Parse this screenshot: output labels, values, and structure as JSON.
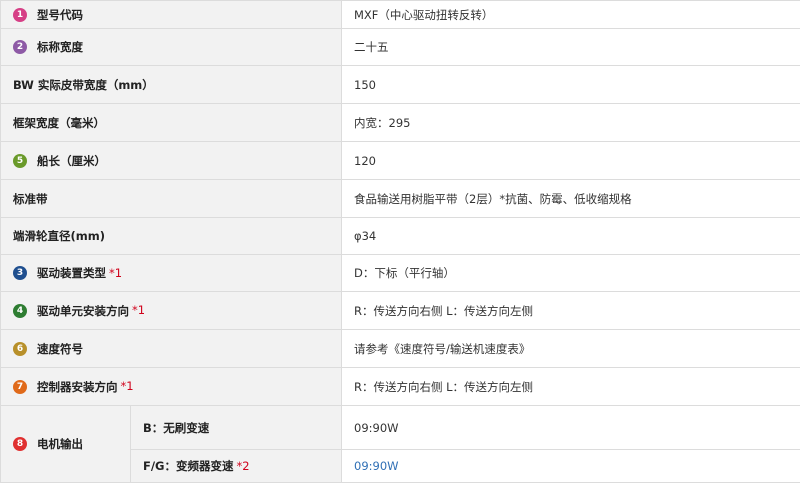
{
  "rows": [
    {
      "num": "1",
      "badge_color": "#d63f86",
      "label": "型号代码",
      "value": "MXF（中心驱动扭转反转）"
    },
    {
      "num": "2",
      "badge_color": "#8e5aa6",
      "label": "标称宽度",
      "value": "二十五"
    },
    {
      "label": "BW 实际皮带宽度（mm）",
      "value": "150"
    },
    {
      "label": "框架宽度（毫米）",
      "value": "内宽：295"
    },
    {
      "num": "5",
      "badge_color": "#6a9a2a",
      "label": "船长（厘米）",
      "value": "120"
    },
    {
      "label": "标准带",
      "value": "食品输送用树脂平带（2层）*抗菌、防霉、低收缩规格"
    },
    {
      "label": "端滑轮直径(mm)",
      "value": "φ34"
    },
    {
      "num": "3",
      "badge_color": "#1f4f8f",
      "label": "驱动装置类型",
      "note": "*1",
      "value": "D：下标（平行轴）"
    },
    {
      "num": "4",
      "badge_color": "#2e7d32",
      "label": "驱动单元安装方向",
      "note": "*1",
      "value": "R：传送方向右侧 L：传送方向左侧"
    },
    {
      "num": "6",
      "badge_color": "#b8902a",
      "label": "速度符号",
      "value": "请参考《速度符号/输送机速度表》"
    },
    {
      "num": "7",
      "badge_color": "#e06a1a",
      "label": "控制器安装方向",
      "note": "*1",
      "value": "R：传送方向右侧 L：传送方向左侧"
    }
  ],
  "motor": {
    "num": "8",
    "badge_color": "#e03030",
    "label": "电机输出",
    "sub1": {
      "label": "B：无刷变速",
      "value": "09:90W"
    },
    "sub2": {
      "label": "F/G：变频器变速",
      "note": "*2",
      "value": "09:90W"
    }
  }
}
